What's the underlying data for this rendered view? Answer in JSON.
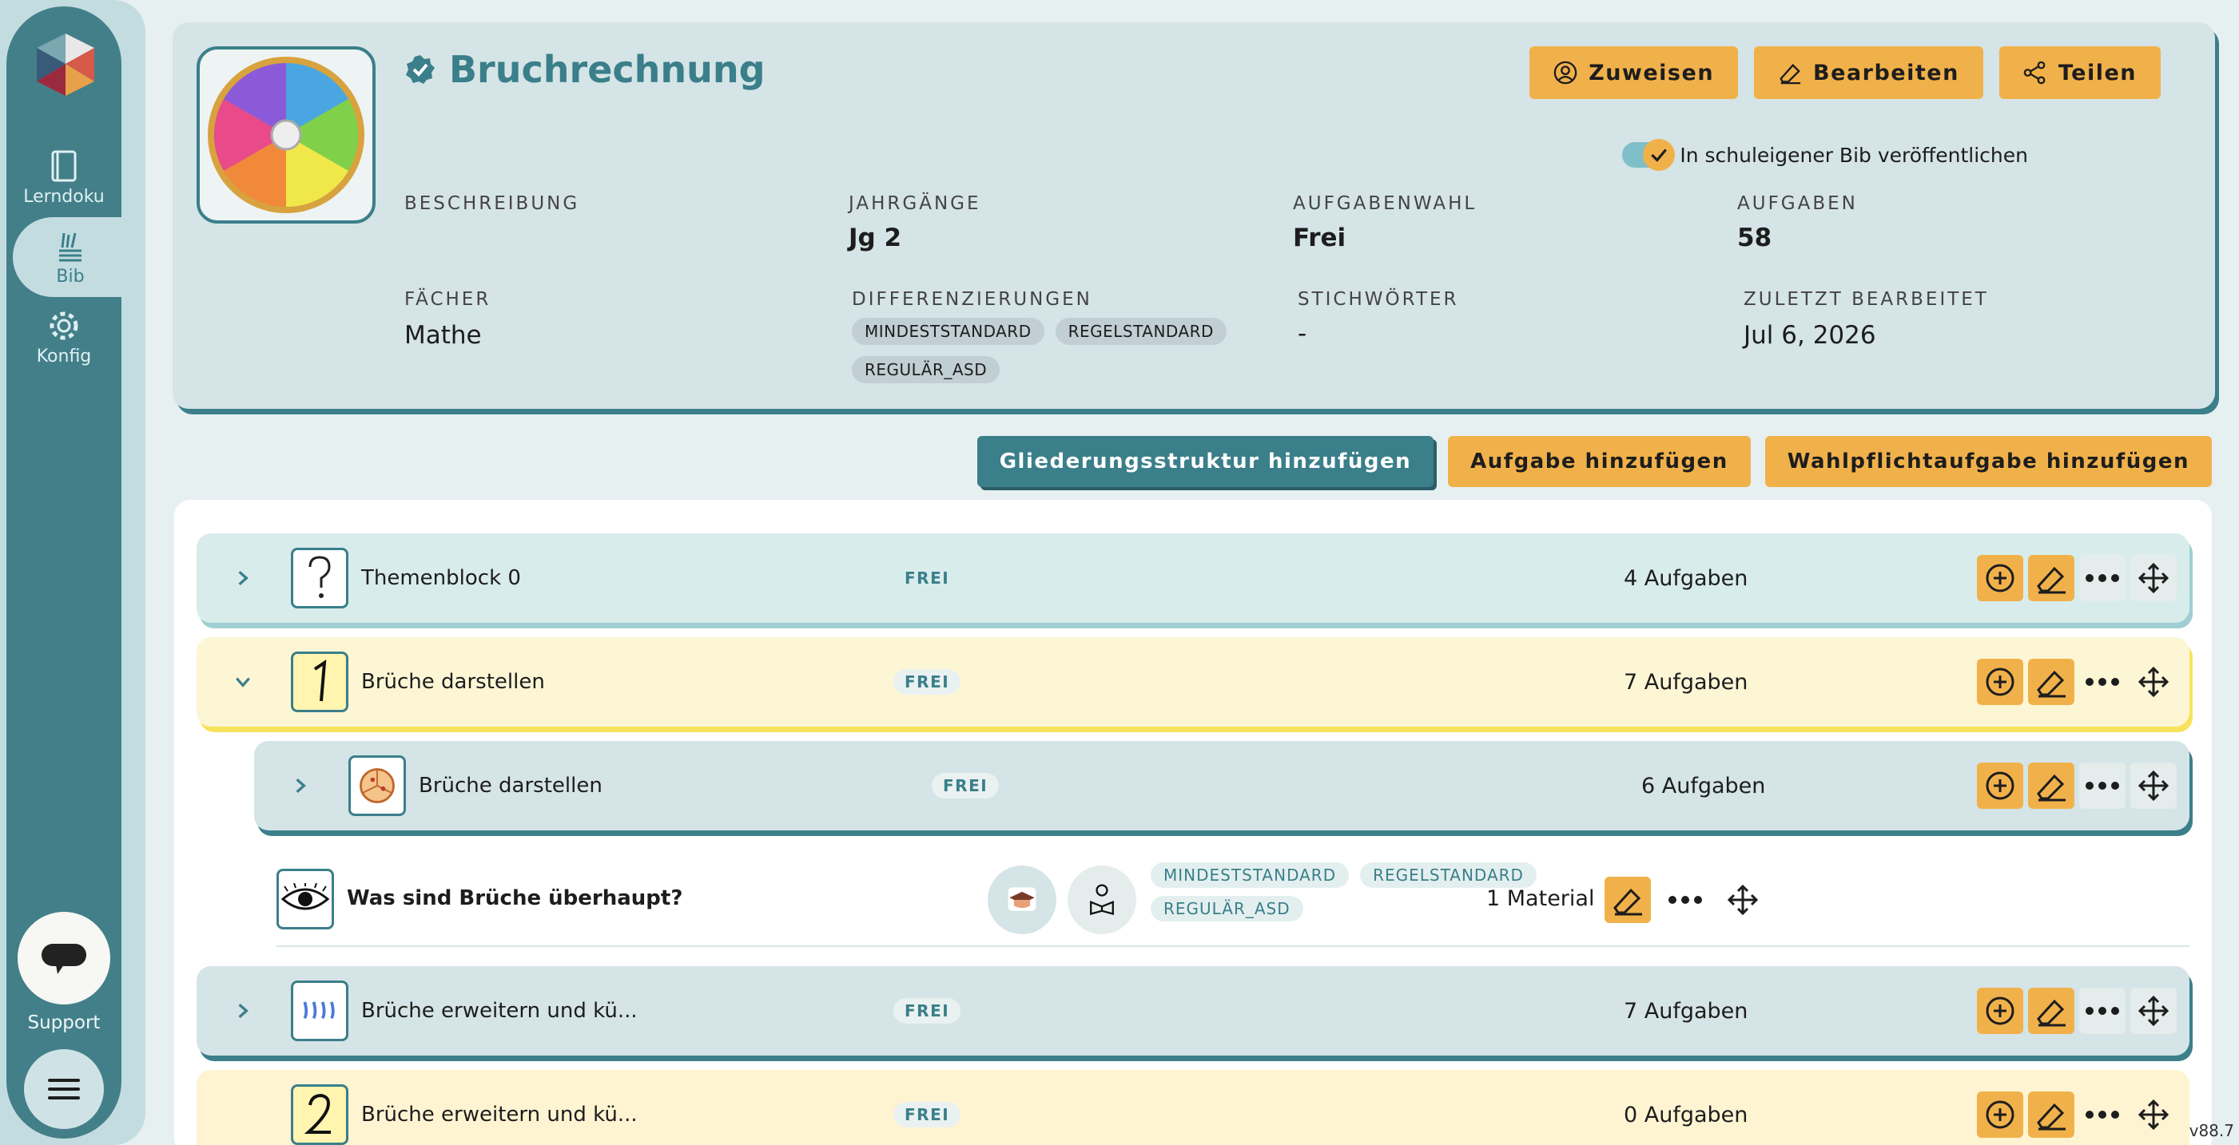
{
  "sidebar": {
    "items": [
      {
        "label": "Lerndoku",
        "icon": "book-icon"
      },
      {
        "label": "Bib",
        "icon": "library-stack-icon"
      },
      {
        "label": "Konfig",
        "icon": "gear-icon"
      }
    ],
    "support_label": "Support"
  },
  "course": {
    "title": "Bruchrechnung",
    "verified_icon": "verified-badge-icon",
    "buttons": {
      "assign": "Zuweisen",
      "edit": "Bearbeiten",
      "share": "Teilen"
    },
    "publish_label": "In schuleigener Bib veröffentlichen",
    "publish_enabled": true,
    "meta": {
      "description_label": "BESCHREIBUNG",
      "grades_label": "JAHRGÄNGE",
      "grades_value": "Jg 2",
      "task_choice_label": "AUFGABENWAHL",
      "task_choice_value": "Frei",
      "tasks_label": "AUFGABEN",
      "tasks_value": "58",
      "subjects_label": "FÄCHER",
      "subjects_value": "Mathe",
      "differentiation_label": "DIFFERENZIERUNGEN",
      "differentiation_chips": [
        "MINDESTSTANDARD",
        "REGELSTANDARD",
        "REGULÄR_ASD"
      ],
      "keywords_label": "STICHWÖRTER",
      "keywords_value": "-",
      "last_edited_label": "ZULETZT BEARBEITET",
      "last_edited_value": "Jul 6, 2026"
    }
  },
  "actions": {
    "add_structure": "Gliederungsstruktur hinzufügen",
    "add_task": "Aufgabe hinzufügen",
    "add_elective": "Wahlpflichtaufgabe hinzufügen"
  },
  "rows": [
    {
      "title": "Themenblock 0",
      "badge": "FREI",
      "count": "4 Aufgaben"
    },
    {
      "title": "Brüche darstellen",
      "badge": "FREI",
      "count": "7 Aufgaben"
    },
    {
      "title": "Brüche darstellen",
      "badge": "FREI",
      "count": "6 Aufgaben"
    },
    {
      "title": "Brüche erweitern und kü...",
      "badge": "FREI",
      "count": "7 Aufgaben"
    },
    {
      "title": "Brüche erweitern und kü...",
      "badge": "FREI",
      "count": "0 Aufgaben"
    }
  ],
  "task": {
    "title": "Was sind Brüche überhaupt?",
    "chips": [
      "MINDESTSTANDARD",
      "REGELSTANDARD",
      "REGULÄR_ASD"
    ],
    "count": "1 Material"
  },
  "version": "v88.7",
  "colors": {
    "primary": "#3a7f8a",
    "accent": "#f1b14a",
    "yellow": "#f7e25c"
  }
}
